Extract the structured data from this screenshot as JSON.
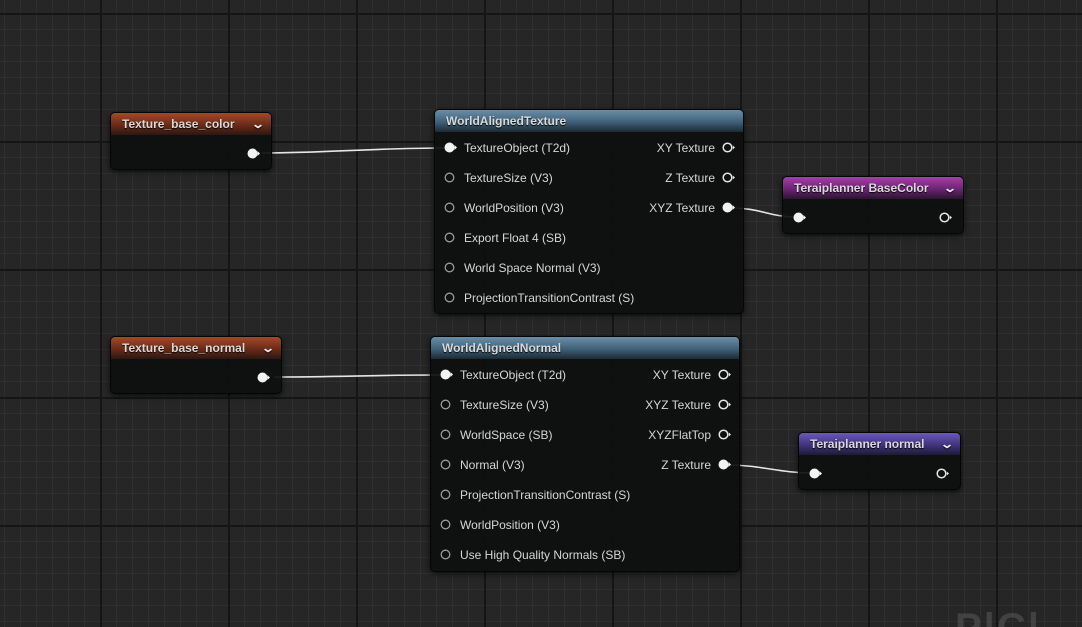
{
  "nodes": {
    "tex_base_color": {
      "title": "Texture_base_color"
    },
    "tex_base_normal": {
      "title": "Texture_base_normal"
    },
    "world_aligned_texture": {
      "title": "WorldAlignedTexture",
      "inputs": [
        "TextureObject (T2d)",
        "TextureSize (V3)",
        "WorldPosition (V3)",
        "Export Float 4 (SB)",
        "World Space Normal (V3)",
        "ProjectionTransitionContrast (S)"
      ],
      "outputs": [
        "XY Texture",
        "Z Texture",
        "XYZ Texture"
      ]
    },
    "world_aligned_normal": {
      "title": "WorldAlignedNormal",
      "inputs": [
        "TextureObject (T2d)",
        "TextureSize (V3)",
        "WorldSpace (SB)",
        "Normal (V3)",
        "ProjectionTransitionContrast (S)",
        "WorldPosition (V3)",
        "Use High Quality Normals (SB)"
      ],
      "outputs": [
        "XY Texture",
        "XYZ Texture",
        "XYZFlatTop",
        "Z Texture"
      ]
    },
    "teraiplanner_basecolor": {
      "title": "Teraiplanner BaseColor"
    },
    "teraiplanner_normal": {
      "title": "Teraiplanner normal"
    }
  },
  "colors": {
    "param_header": "#8a3b20",
    "function_header": "#4f7490",
    "basecolor_header": "#8a3490",
    "normal_header": "#54469a",
    "grid_bg": "#262626",
    "wire": "#e6e6e6"
  },
  "icons": {
    "collapse": "chevron-down-icon",
    "pin_connected": "pin-filled-icon",
    "pin_unconnected": "pin-hollow-icon"
  },
  "watermark": "P|C|"
}
